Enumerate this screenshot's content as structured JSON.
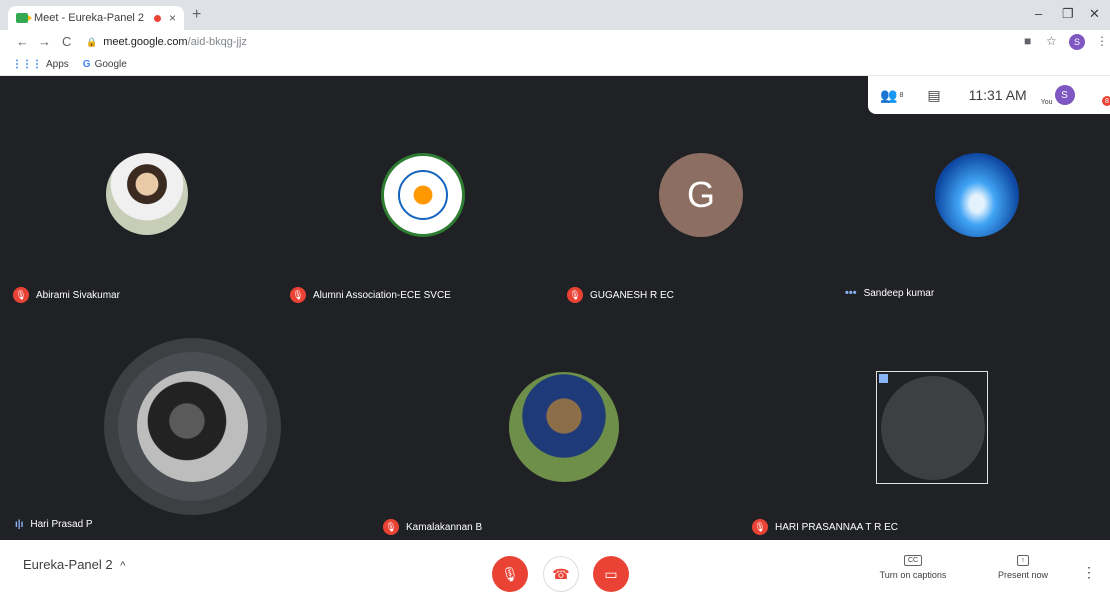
{
  "browser": {
    "tab_title": "Meet - Eureka-Panel 2",
    "tab_close": "×",
    "new_tab": "+",
    "url_domain": "meet.google.com",
    "url_path": "/aid-bkqg-jjz",
    "profile_initial": "S",
    "bookmarks": [
      {
        "icon": "apps-grid-icon",
        "label": "Apps"
      },
      {
        "icon": "google-g-icon",
        "label": "Google"
      }
    ]
  },
  "meet": {
    "participant_count": "8",
    "time": "11:31 AM",
    "you_label": "You",
    "self_initial": "S",
    "notification_count": "8",
    "participants": [
      {
        "name": "Abirami Sivakumar",
        "status": "muted",
        "avatar": "photo"
      },
      {
        "name": "Alumni Association-ECE SVCE",
        "status": "muted",
        "avatar": "logo"
      },
      {
        "name": "GUGANESH R EC",
        "status": "muted",
        "avatar": "initial",
        "initial": "G",
        "color": "#8d6e63"
      },
      {
        "name": "Sandeep kumar",
        "status": "connecting",
        "avatar": "photo"
      },
      {
        "name": "Hari Prasad P",
        "status": "speaking",
        "avatar": "photo"
      },
      {
        "name": "Kamalakannan B",
        "status": "muted",
        "avatar": "photo"
      },
      {
        "name": "HARI PRASANNAA T R EC",
        "status": "muted",
        "avatar": "broken-image"
      }
    ]
  },
  "bottombar": {
    "meeting_name": "Eureka-Panel 2",
    "captions_label": "Turn on captions",
    "captions_icon": "CC",
    "present_label": "Present now",
    "accent_red": "#ea4335"
  }
}
